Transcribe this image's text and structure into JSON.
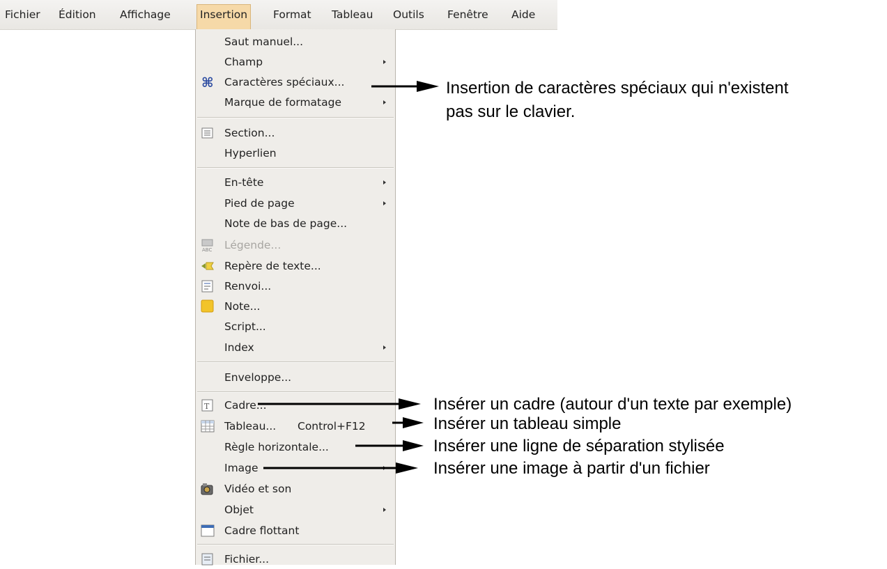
{
  "menubar": {
    "items": [
      "Fichier",
      "Édition",
      "Affichage",
      "Insertion",
      "Format",
      "Tableau",
      "Outils",
      "Fenêtre",
      "Aide"
    ],
    "active": "Insertion"
  },
  "menu": {
    "title": "Insertion",
    "items": [
      {
        "label": "Saut manuel..."
      },
      {
        "label": "Champ",
        "submenu": true
      },
      {
        "label": "Caractères spéciaux...",
        "icon": "special-characters-icon"
      },
      {
        "label": "Marque de formatage",
        "submenu": true
      },
      {
        "label": "Section...",
        "icon": "section-icon"
      },
      {
        "label": "Hyperlien"
      },
      {
        "label": "En-tête",
        "submenu": true
      },
      {
        "label": "Pied de page",
        "submenu": true
      },
      {
        "label": "Note de bas de page..."
      },
      {
        "label": "Légende...",
        "icon": "caption-icon",
        "disabled": true
      },
      {
        "label": "Repère de texte...",
        "icon": "bookmark-icon"
      },
      {
        "label": "Renvoi...",
        "icon": "cross-reference-icon"
      },
      {
        "label": "Note...",
        "icon": "note-icon"
      },
      {
        "label": "Script..."
      },
      {
        "label": "Index",
        "submenu": true
      },
      {
        "label": "Enveloppe..."
      },
      {
        "label": "Cadre...",
        "icon": "frame-icon"
      },
      {
        "label": "Tableau...",
        "shortcut": "Control+F12",
        "icon": "table-icon"
      },
      {
        "label": "Règle horizontale..."
      },
      {
        "label": "Image",
        "submenu": true
      },
      {
        "label": "Vidéo et son",
        "icon": "video-sound-icon"
      },
      {
        "label": "Objet",
        "submenu": true
      },
      {
        "label": "Cadre flottant",
        "icon": "floating-frame-icon"
      },
      {
        "label": "Fichier...",
        "icon": "file-icon"
      }
    ]
  },
  "annotations": {
    "caracteres_line1": "Insertion de caractères spéciaux qui n'existent",
    "caracteres_line2": "pas sur le clavier.",
    "cadre": "Insérer un cadre (autour d'un texte par exemple)",
    "tableau": "Insérer un tableau simple",
    "regle": "Insérer une ligne de séparation stylisée",
    "image": "Insérer une image à partir d'un fichier"
  },
  "colors": {
    "menu_background": "#efede9",
    "active_menu_highlight": "#f6d9a8",
    "note_icon": "#f2c42a",
    "special_chars_icon": "#2a4aa0"
  }
}
